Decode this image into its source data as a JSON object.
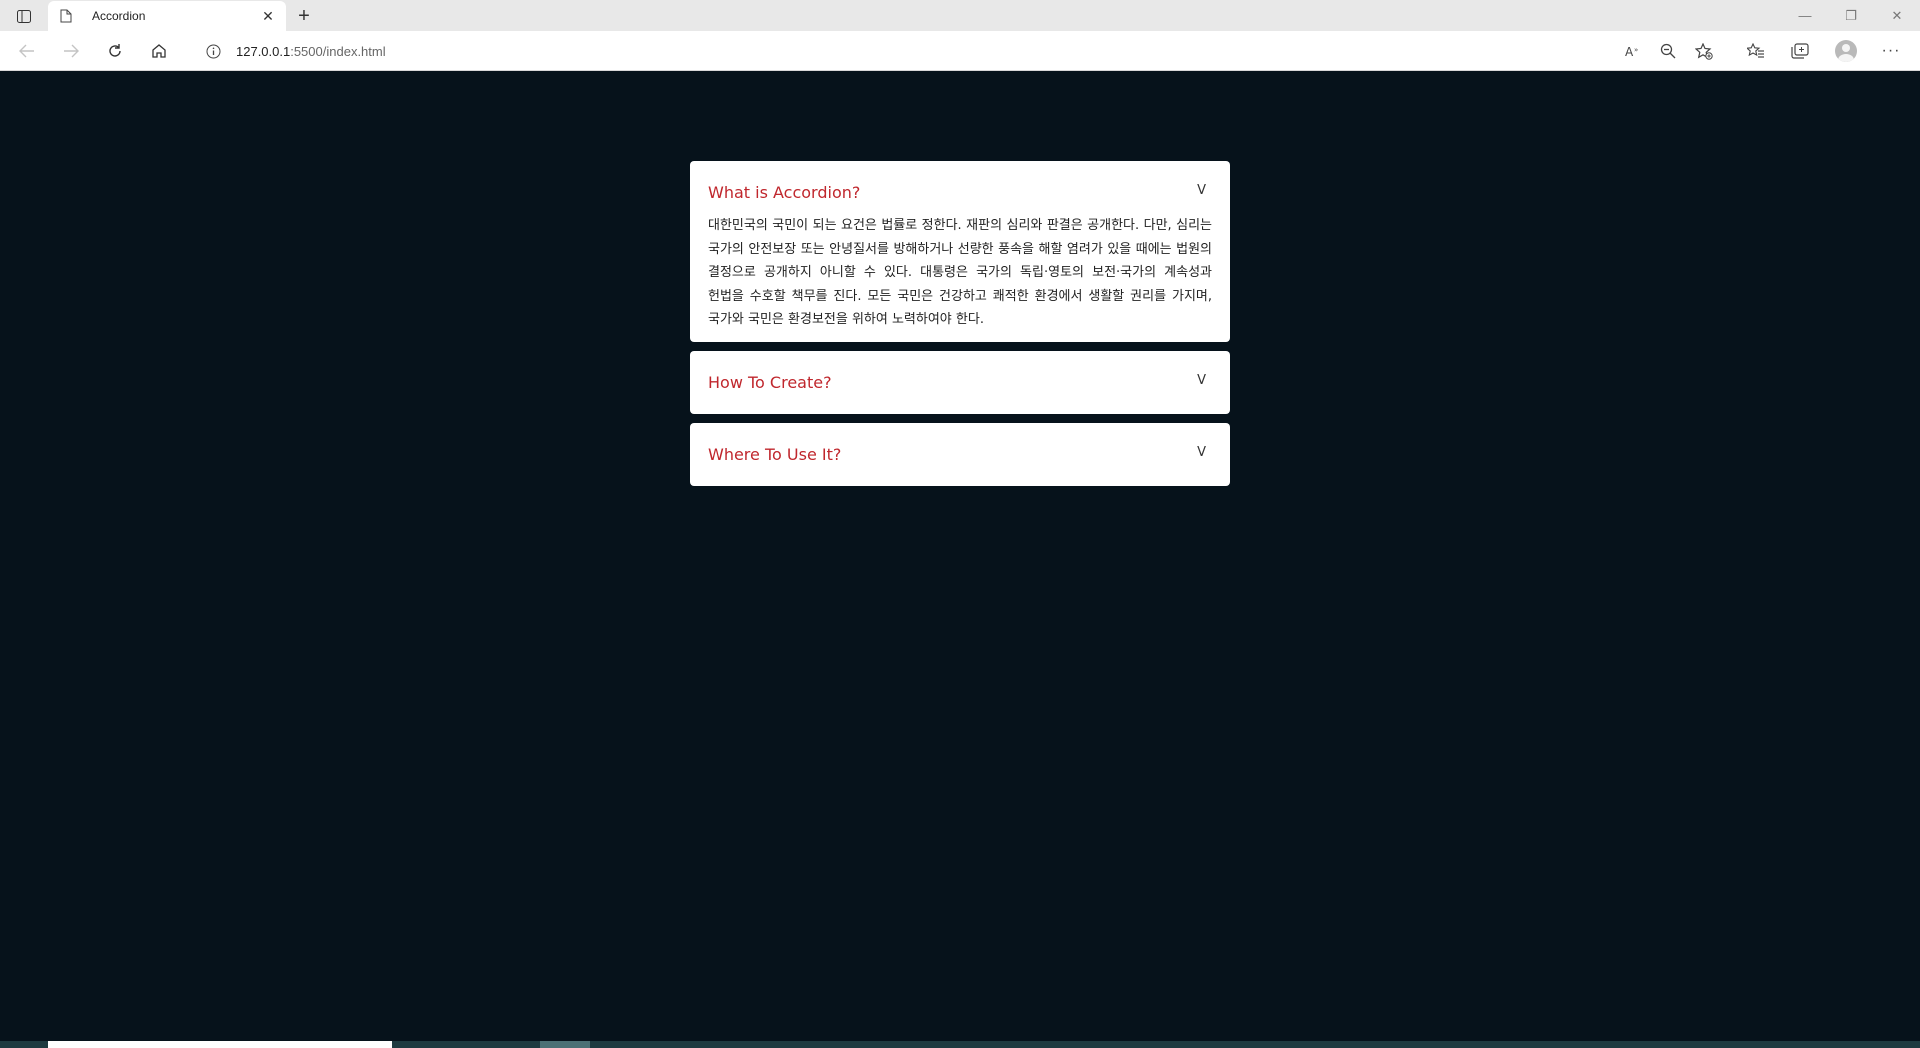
{
  "browser": {
    "tab_title": "Accordion",
    "url_host": "127.0.0.1",
    "url_rest": ":5500/index.html",
    "icons": [
      "tab-actions-icon",
      "document-icon",
      "close-icon",
      "plus-icon",
      "back-icon",
      "forward-icon",
      "refresh-icon",
      "home-icon",
      "info-icon",
      "read-aloud-icon",
      "zoom-out-icon",
      "add-favorite-icon",
      "favorites-icon",
      "collections-icon",
      "profile-icon",
      "more-icon",
      "minimize-icon",
      "restore-icon",
      "window-close-icon"
    ]
  },
  "accordion": {
    "items": [
      {
        "title": "What is Accordion?",
        "toggle": "V",
        "expanded": true,
        "body": "대한민국의 국민이 되는 요건은 법률로 정한다. 재판의 심리와 판결은 공개한다. 다만, 심리는 국가의 안전보장 또는 안녕질서를 방해하거나 선량한 풍속을 해할 염려가 있을 때에는 법원의 결정으로 공개하지 아니할 수 있다. 대통령은 국가의 독립·영토의 보전·국가의 계속성과 헌법을 수호할 책무를 진다. 모든 국민은 건강하고 쾌적한 환경에서 생활할 권리를 가지며, 국가와 국민은 환경보전을 위하여 노력하여야 한다."
      },
      {
        "title": "How To Create?",
        "toggle": "V",
        "expanded": false
      },
      {
        "title": "Where To Use It?",
        "toggle": "V",
        "expanded": false
      }
    ]
  },
  "colors": {
    "page_background": "#06121b",
    "card_background": "#ffffff",
    "title_red": "#c0272d"
  }
}
